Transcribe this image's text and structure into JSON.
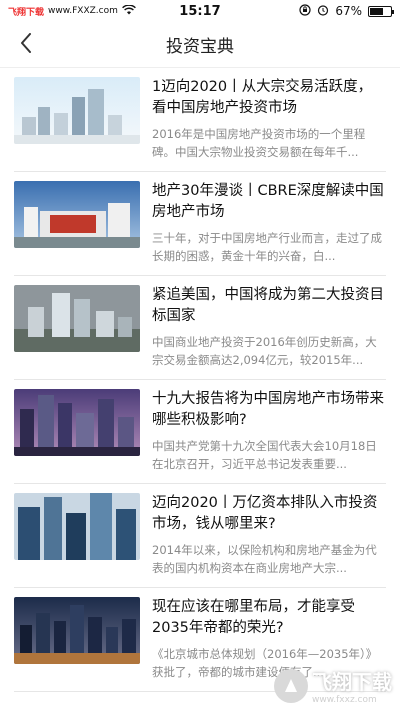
{
  "status_bar": {
    "carrier": "飞翔下载",
    "site": "www.FXXZ.com",
    "time": "15:17",
    "battery_percent": "67%",
    "battery_level": 0.67,
    "icons": [
      "wifi-icon",
      "lock-rotation-icon",
      "alarm-icon",
      "battery-icon"
    ]
  },
  "nav": {
    "title": "投资宝典",
    "back_icon": "chevron-left-icon"
  },
  "articles": [
    {
      "title": "1迈向2020丨从大宗交易活跃度，看中国房地产投资市场",
      "summary": "2016年是中国房地产投资市场的一个里程碑。中国大宗物业投资交易额在每年千...",
      "thumb": "light-blue-city-towers"
    },
    {
      "title": "地产30年漫谈丨CBRE深度解读中国房地产市场",
      "summary": "三十年，对于中国房地产行业而言，走过了成长期的困惑，黄金十年的兴奋，白...",
      "thumb": "red-white-building"
    },
    {
      "title": "紧追美国，中国将成为第二大投资目标国家",
      "summary": "中国商业地产投资于2016年创历史新高，大宗交易金额高达2,094亿元，较2015年...",
      "thumb": "grey-aerial-towers"
    },
    {
      "title": "十九大报告将为中国房地产市场带来哪些积极影响?",
      "summary": "中国共产党第十九次全国代表大会10月18日在北京召开，习近平总书记发表重要...",
      "thumb": "purple-dusk-skyline"
    },
    {
      "title": "迈向2020丨万亿资本排队入市投资市场，钱从哪里来?",
      "summary": "2014年以来，以保险机构和房地产基金为代表的国内机构资本在商业房地产大宗...",
      "thumb": "blue-glass-skyscrapers"
    },
    {
      "title": "现在应该在哪里布局，才能享受2035年帝都的荣光?",
      "summary": "《北京城市总体规划（2016年—2035年）》获批了，帝都的城市建设便有了...",
      "thumb": "night-cbd-skyline"
    }
  ],
  "watermark": {
    "text": "飞翔下载",
    "url": "www.fxxz.com"
  }
}
